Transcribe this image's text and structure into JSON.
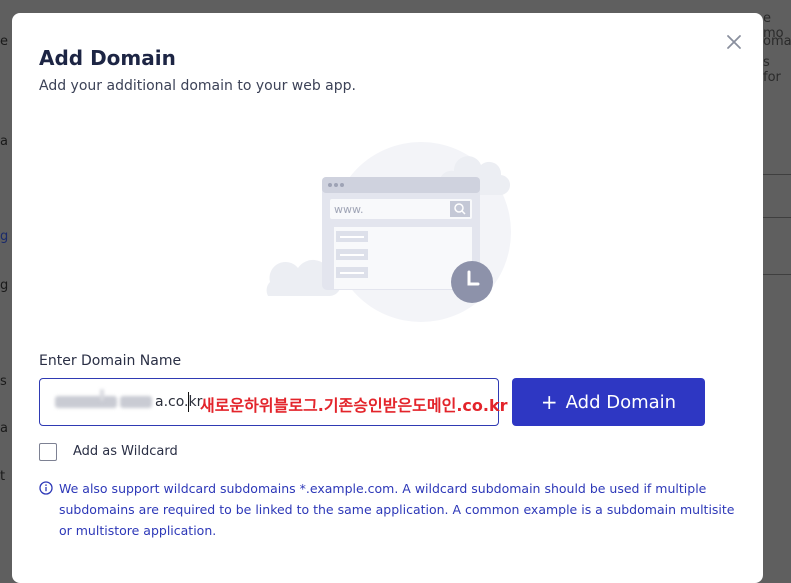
{
  "background": {
    "right_fragments": [
      "e mo",
      "omain",
      "s for"
    ],
    "left_fragments": [
      "e",
      "a",
      "g",
      "g",
      "s",
      "a",
      "t"
    ]
  },
  "modal": {
    "title": "Add Domain",
    "subtitle": "Add your additional domain to your web app.",
    "close_icon": "close-icon"
  },
  "illustration": {
    "url_text": "www."
  },
  "form": {
    "label": "Enter Domain Name",
    "input_value_visible": "a.co.kr",
    "annotation": "새로운하위블로그.기존승인받은도메인.co.kr",
    "add_button_label": "Add Domain",
    "add_button_icon": "+",
    "wildcard_label": "Add as Wildcard",
    "wildcard_checked": false
  },
  "info": {
    "text": "We also support wildcard subdomains *.example.com. A wildcard subdomain should be used if multiple subdomains are required to be linked to the same application. A common example is a subdomain multisite or multistore application."
  },
  "colors": {
    "primary": "#2e37c3",
    "title": "#1d2544",
    "annotation": "#e3242b",
    "info": "#2d38b8"
  }
}
